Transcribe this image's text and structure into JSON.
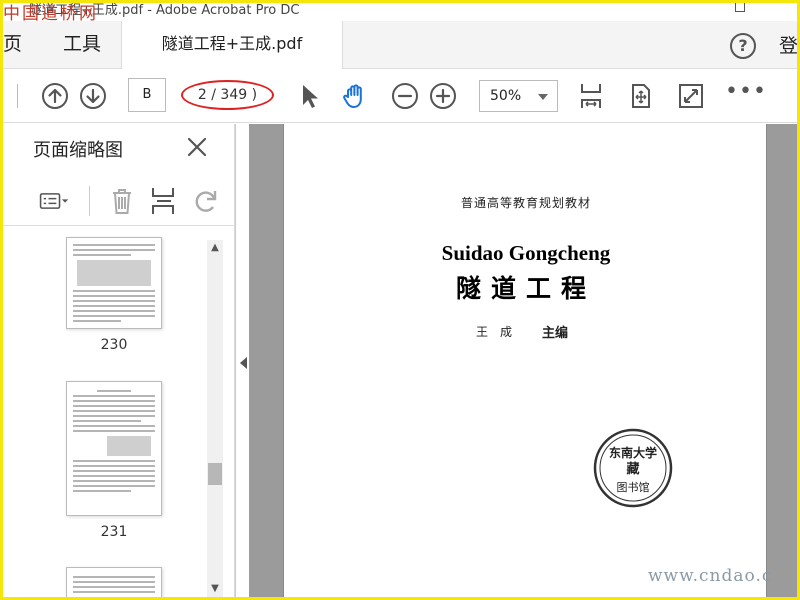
{
  "window": {
    "title": "隧道工程+王成.pdf - Adobe Acrobat Pro DC",
    "watermark_top": "中国道桥网"
  },
  "menu": {
    "home_label": "页",
    "tools_label": "工具",
    "doc_tab_label": "隧道工程+王成.pdf",
    "help_label": "?",
    "signin_label": "登"
  },
  "toolbar": {
    "page_input": "B",
    "page_count": "2 / 349 )",
    "zoom_value": "50%",
    "more_label": "•••"
  },
  "thumbnails": {
    "title": "页面缩略图",
    "pages": [
      {
        "label": "230"
      },
      {
        "label": "231"
      }
    ]
  },
  "document": {
    "series": "普通高等教育规划教材",
    "pinyin_title": "Suidao Gongcheng",
    "chinese_title": "隧道工程",
    "author": "王成",
    "role": "主编",
    "stamp_text": "东南大学",
    "stamp_bottom": "图书馆"
  },
  "watermark_bottom": "www.cndao.c",
  "colors": {
    "frame": "#f5e60a",
    "annotation_red": "#dd2222",
    "hand_tool_blue": "#1a73d9",
    "canvas_gray": "#9b9b9b"
  }
}
